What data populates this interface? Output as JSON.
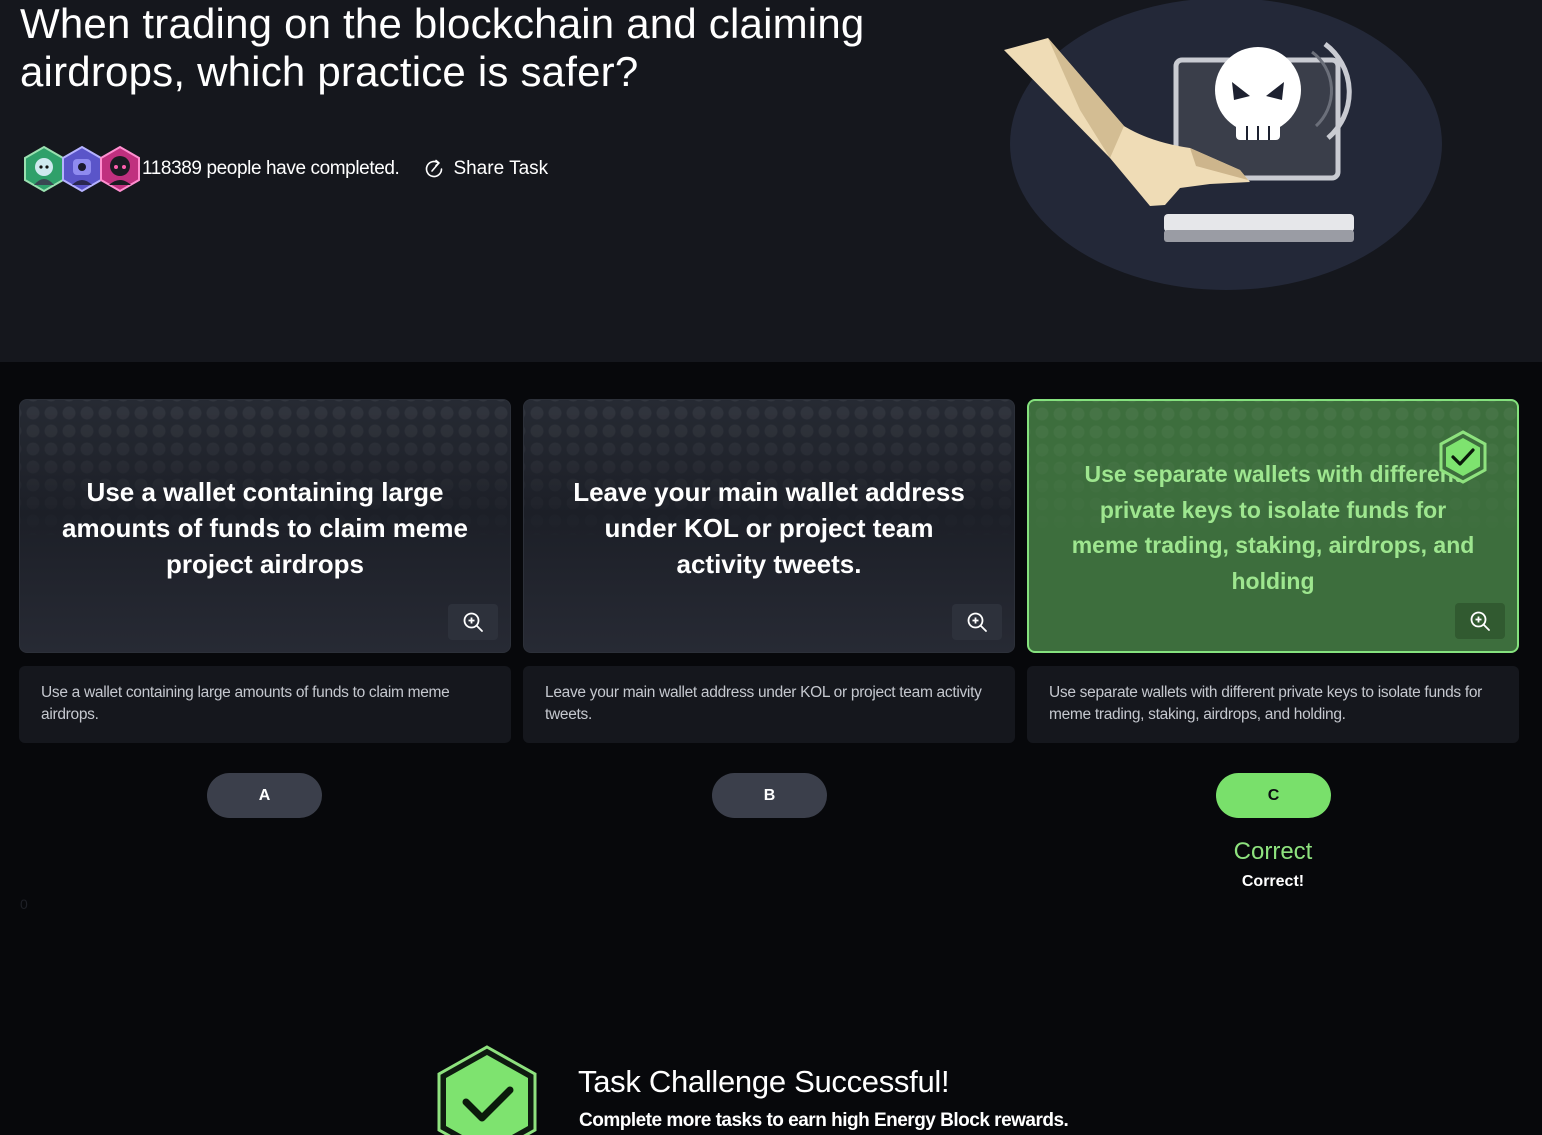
{
  "question": {
    "title": "When trading on the blockchain and claiming airdrops, which practice is safer?"
  },
  "completion": {
    "text": "118389 people have completed."
  },
  "share": {
    "label": "Share Task"
  },
  "options": [
    {
      "card_text": "Use a wallet containing large amounts of funds to claim meme project airdrops",
      "description": "Use a wallet containing large amounts of funds to claim meme airdrops.",
      "letter": "A",
      "selected": false
    },
    {
      "card_text": "Leave your main wallet address under KOL or project team activity tweets.",
      "description": "Leave your main wallet address under KOL or project team activity tweets.",
      "letter": "B",
      "selected": false
    },
    {
      "card_text": "Use separate wallets with different private keys to isolate funds for meme trading, staking, airdrops, and holding",
      "description": "Use separate wallets with different private keys to isolate funds for meme trading, staking, airdrops, and holding.",
      "letter": "C",
      "selected": true,
      "correct": true
    }
  ],
  "result": {
    "status": "Correct",
    "message": "Correct!"
  },
  "stray_counter": "0",
  "success": {
    "title": "Task Challenge Successful!",
    "subtitle": "Complete more tasks to earn high Energy Block rewards."
  },
  "colors": {
    "accent_green": "#79e06b",
    "correct_card": "#3d6e3d",
    "background": "#07080b",
    "hero": "#15171d"
  }
}
